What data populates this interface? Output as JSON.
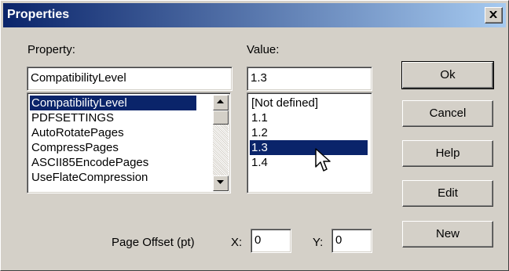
{
  "window": {
    "title": "Properties"
  },
  "labels": {
    "property": "Property:",
    "value": "Value:",
    "page_offset": "Page Offset (pt)",
    "x": "X:",
    "y": "Y:"
  },
  "property_input": {
    "value": "CompatibilityLevel"
  },
  "value_input": {
    "value": "1.3"
  },
  "property_list": {
    "items": [
      "CompatibilityLevel",
      "PDFSETTINGS",
      "AutoRotatePages",
      "CompressPages",
      "ASCII85EncodePages",
      "UseFlateCompression"
    ],
    "selected": "CompatibilityLevel"
  },
  "value_list": {
    "items": [
      "[Not defined]",
      "1.1",
      "1.2",
      "1.3",
      "1.4"
    ],
    "selected": "1.3"
  },
  "offset": {
    "x": "0",
    "y": "0"
  },
  "buttons": {
    "ok": "Ok",
    "cancel": "Cancel",
    "help": "Help",
    "edit": "Edit",
    "new": "New"
  },
  "colors": {
    "face": "#d4d0c8",
    "title_start": "#0a246a",
    "title_end": "#a6caf0",
    "selection": "#0a246a"
  },
  "icons": {
    "close": "close-icon",
    "scroll_up": "arrow-up-icon",
    "scroll_down": "arrow-down-icon",
    "cursor": "mouse-pointer-icon"
  }
}
